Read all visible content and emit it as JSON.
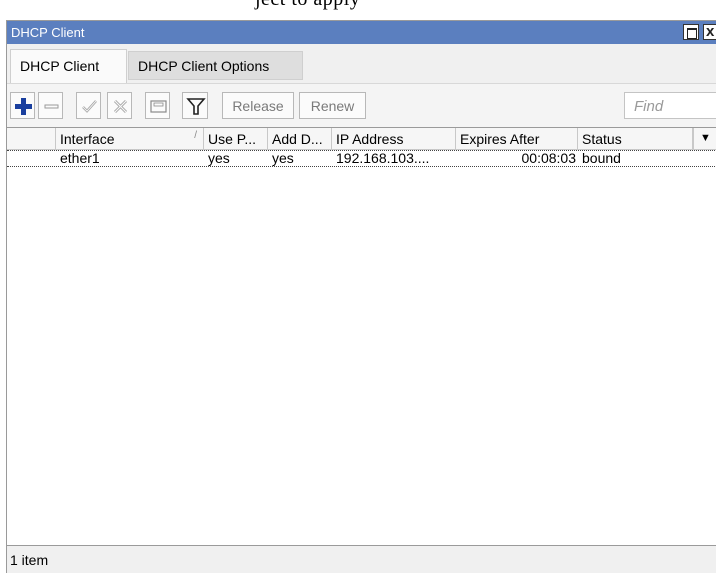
{
  "document": {
    "partial_text": "ject to apply"
  },
  "window": {
    "title": "DHCP Client",
    "controls": {
      "maximize": "maximize-icon",
      "close_label": "x"
    }
  },
  "tabs": [
    {
      "label": "DHCP Client",
      "active": true
    },
    {
      "label": "DHCP Client Options",
      "active": false
    }
  ],
  "toolbar": {
    "icons": [
      "add-icon",
      "remove-icon",
      "enable-icon",
      "disable-icon",
      "comment-icon",
      "filter-icon"
    ],
    "colors": {
      "add": "#1a3f9e"
    },
    "release_label": "Release",
    "renew_label": "Renew",
    "find_placeholder": "Find"
  },
  "table": {
    "columns": [
      "Interface",
      "Use P...",
      "Add D...",
      "IP Address",
      "Expires After",
      "Status"
    ],
    "sort_indicator": "/",
    "menu_glyph": "▼",
    "rows": [
      {
        "interface": "ether1",
        "use_peer": "yes",
        "add_default": "yes",
        "ip_address": "192.168.103....",
        "expires_after": "00:08:03",
        "status": "bound"
      }
    ]
  },
  "status_bar": {
    "text": "1 item"
  },
  "colors": {
    "titlebar": "#5b7fbf",
    "window_bg": "#f0f0f0"
  }
}
